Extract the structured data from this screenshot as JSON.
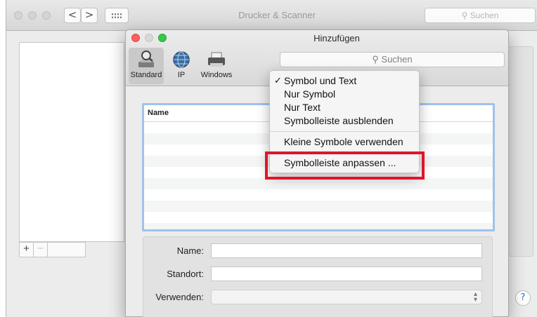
{
  "back_window": {
    "title": "Drucker & Scanner",
    "search_placeholder": "Suchen",
    "nav_back": "<",
    "nav_forward": ">",
    "add_symbol": "+",
    "remove_symbol": "−",
    "help_symbol": "?"
  },
  "sheet": {
    "title": "Hinzufügen",
    "search_placeholder": "Suchen",
    "toolbar": {
      "standard": "Standard",
      "ip": "IP",
      "windows": "Windows"
    },
    "table": {
      "column_name": "Name"
    },
    "form": {
      "name_label": "Name:",
      "location_label": "Standort:",
      "use_label": "Verwenden:",
      "name_value": "",
      "location_value": "",
      "use_value": ""
    }
  },
  "menu": {
    "checkmark": "✓",
    "items": [
      "Symbol und Text",
      "Nur Symbol",
      "Nur Text",
      "Symbolleiste ausblenden",
      "Kleine Symbole verwenden",
      "Symbolleiste anpassen ..."
    ],
    "selected_index": 0
  },
  "colors": {
    "highlight": "#e0152a",
    "traffic_red": "#fc605c",
    "traffic_yellow": "#d8d8d8",
    "traffic_green": "#34c84a",
    "focus_ring": "#9fc2ec"
  }
}
